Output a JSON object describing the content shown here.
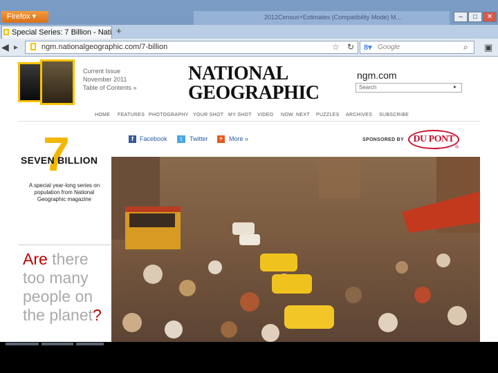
{
  "browser": {
    "app_button": "Firefox ▾",
    "background_window_title": "2012Census+Estimates (Compatibility Mode) M...",
    "tab_title": "Special Series: 7 Billion - Nation...",
    "new_tab": "+",
    "url": "ngm.nationalgeographic.com/7-billion",
    "search_placeholder": "Google",
    "search_engine_icon": "google-icon",
    "window_controls": [
      "–",
      "□",
      "✕"
    ]
  },
  "header": {
    "current_issue": [
      "Current Issue",
      "November 2011",
      "Table of Contents »"
    ],
    "logo_lines": [
      "NATIONAL",
      "GEOGRAPHIC"
    ],
    "site": "ngm.com",
    "search_placeholder": "Search",
    "nav": [
      "HOME",
      "FEATURES",
      "PHOTOGRAPHY",
      "YOUR SHOT",
      "MY SHOT",
      "VIDEO",
      "NOW",
      "NEXT",
      "PUZZLES",
      "ARCHIVES",
      "SUBSCRIBE"
    ]
  },
  "series": {
    "numeral": "7",
    "title": "SEVEN BILLION",
    "description": "A special year-long series on population from National Geographic magazine",
    "question_are": "Are",
    "question_middle": " there too many people on the planet",
    "question_mark": "?"
  },
  "social": {
    "facebook": "Facebook",
    "twitter": "Twitter",
    "more": "More »"
  },
  "sponsor": {
    "label": "SPONSORED BY",
    "name": "DU PONT",
    "reg": "®"
  },
  "colors": {
    "accent_yellow": "#f2b800",
    "question_red": "#b00000",
    "dupont_red": "#c8102e"
  }
}
